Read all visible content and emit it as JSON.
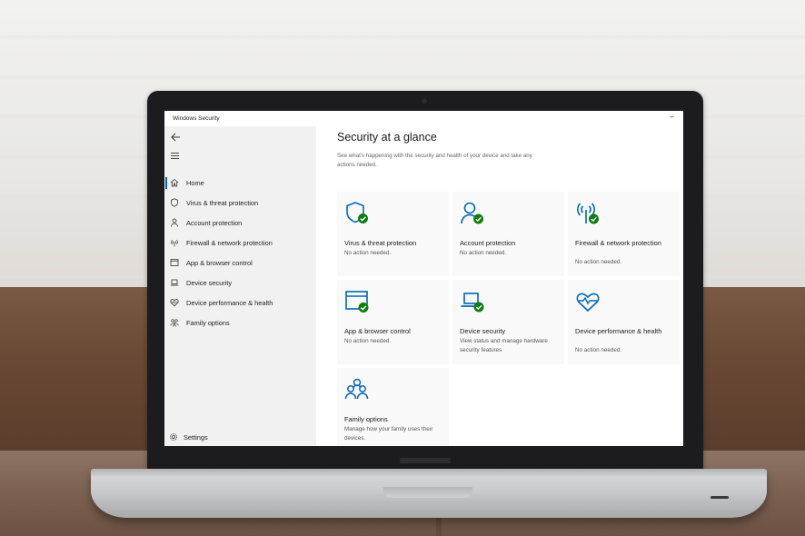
{
  "window": {
    "title": "Windows Security",
    "minimize_glyph": "–"
  },
  "sidebar": {
    "back_icon": "back-arrow-icon",
    "menu_icon": "hamburger-menu-icon",
    "items": [
      {
        "label": "Home",
        "icon": "home-icon",
        "active": true
      },
      {
        "label": "Virus & threat protection",
        "icon": "shield-icon"
      },
      {
        "label": "Account protection",
        "icon": "person-icon"
      },
      {
        "label": "Firewall & network protection",
        "icon": "wifi-antenna-icon"
      },
      {
        "label": "App & browser control",
        "icon": "browser-window-icon"
      },
      {
        "label": "Device security",
        "icon": "laptop-icon"
      },
      {
        "label": "Device performance & health",
        "icon": "heart-pulse-icon"
      },
      {
        "label": "Family options",
        "icon": "family-icon"
      }
    ],
    "settings_label": "Settings"
  },
  "main": {
    "title": "Security at a glance",
    "subtitle": "See what's happening with the security and health of your device and take any actions needed.",
    "tiles": [
      {
        "title": "Virus & threat protection",
        "status": "No action needed.",
        "icon": "shield-check-icon"
      },
      {
        "title": "Account protection",
        "status": "No action needed.",
        "icon": "person-check-icon"
      },
      {
        "title": "Firewall & network protection",
        "status": "No action needed.",
        "icon": "antenna-check-icon"
      },
      {
        "title": "App & browser control",
        "status": "No action needed.",
        "icon": "browser-check-icon"
      },
      {
        "title": "Device security",
        "status": "View status and manage hardware security features",
        "icon": "laptop-check-icon"
      },
      {
        "title": "Device performance & health",
        "status": "No action needed.",
        "icon": "heart-pulse-icon"
      },
      {
        "title": "Family options",
        "status": "Manage how your family uses their devices.",
        "icon": "family-icon"
      }
    ]
  },
  "colors": {
    "accent": "#0067b8",
    "ok_green": "#107c10",
    "sidebar_bg": "#f1f1f1",
    "tile_bg": "#f9f9f9"
  }
}
